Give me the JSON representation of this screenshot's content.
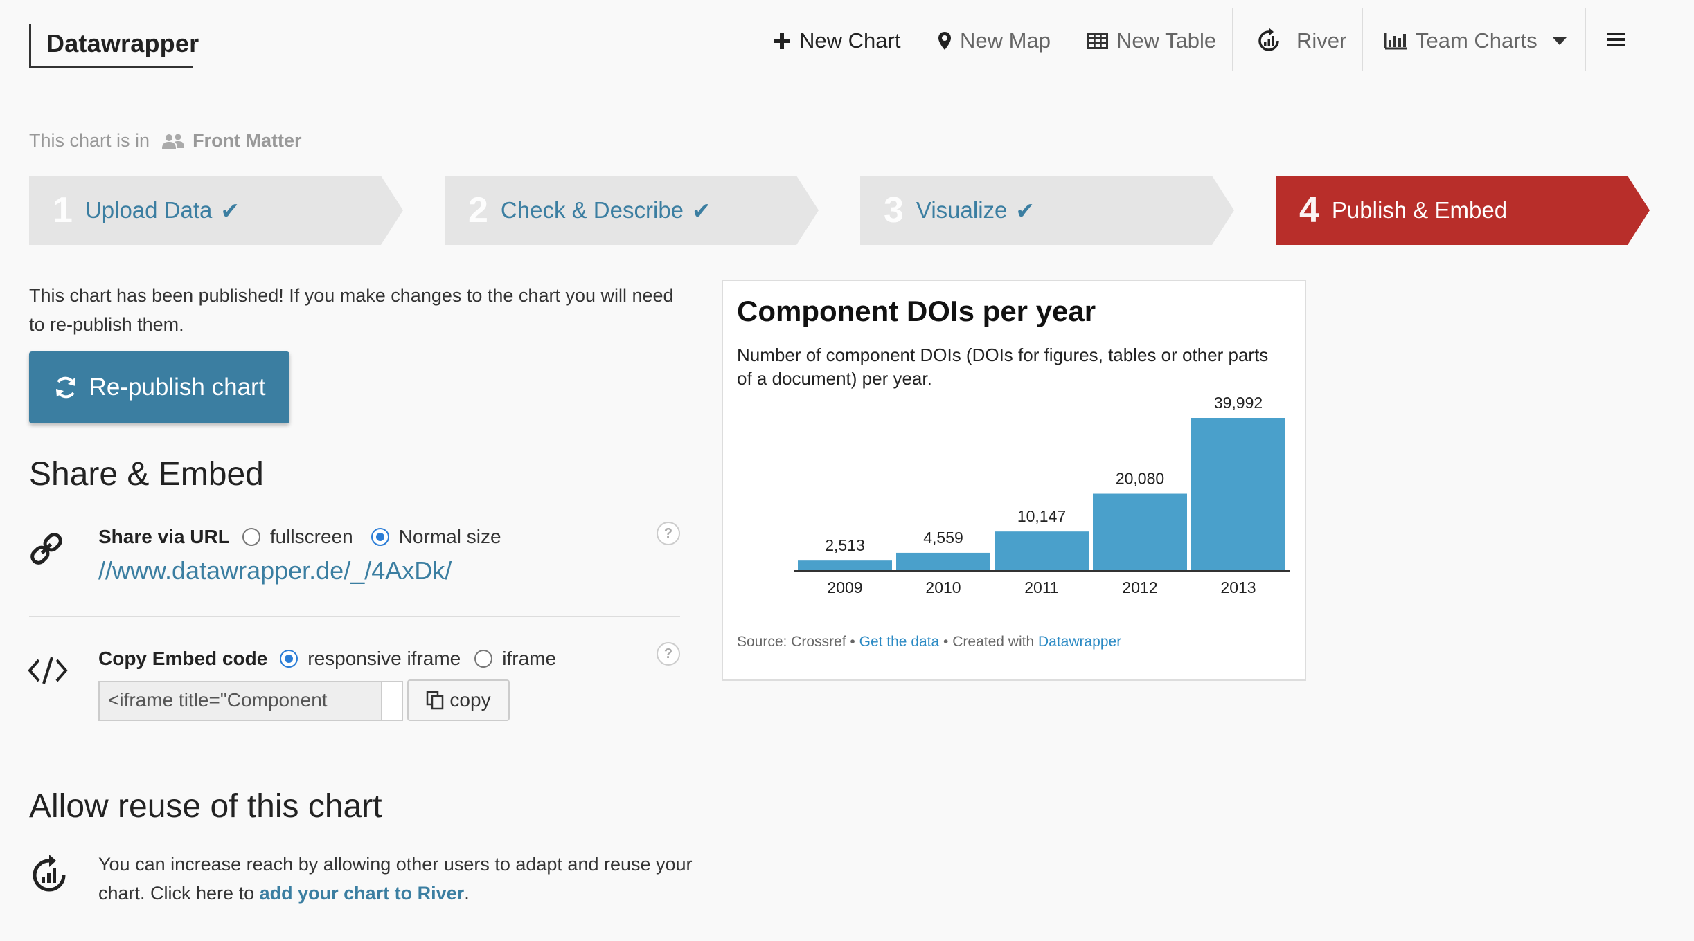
{
  "header": {
    "logo": "Datawrapper",
    "nav": {
      "new_chart": "New Chart",
      "new_map": "New Map",
      "new_table": "New Table",
      "river": "River",
      "team_charts": "Team Charts"
    }
  },
  "folder": {
    "prefix": "This chart is in",
    "name": "Front Matter"
  },
  "steps": [
    {
      "num": "1",
      "label": "Upload Data",
      "check": "✔"
    },
    {
      "num": "2",
      "label": "Check & Describe",
      "check": "✔"
    },
    {
      "num": "3",
      "label": "Visualize",
      "check": "✔"
    },
    {
      "num": "4",
      "label": "Publish & Embed"
    }
  ],
  "publish": {
    "notice": "This chart has been published! If you make changes to the chart you will need to re-publish them.",
    "republish_label": "Re-publish chart"
  },
  "share": {
    "heading": "Share & Embed",
    "url_label": "Share via URL",
    "opt_fullscreen": "fullscreen",
    "opt_normal": "Normal size",
    "url": "//www.datawrapper.de/_/4AxDk/",
    "embed_label": "Copy Embed code",
    "opt_responsive": "responsive iframe",
    "opt_iframe": "iframe",
    "embed_code": "<iframe title=\"Component",
    "copy_label": "copy",
    "help": "?"
  },
  "reuse": {
    "heading": "Allow reuse of this chart",
    "text": "You can increase reach by allowing other users to adapt and reuse your chart. Click here to",
    "link": "add your chart to River",
    "end": "."
  },
  "chart_data": {
    "type": "bar",
    "title": "Component DOIs per year",
    "subtitle": "Number of component DOIs (DOIs for figures, tables or other parts of a document) per year.",
    "categories": [
      "2009",
      "2010",
      "2011",
      "2012",
      "2013"
    ],
    "values": [
      2513,
      4559,
      10147,
      20080,
      39992
    ],
    "value_labels": [
      "2,513",
      "4,559",
      "10,147",
      "20,080",
      "39,992"
    ],
    "bar_color": "#4aa0cb",
    "source_prefix": "Source: Crossref",
    "get_data": "Get the data",
    "created_with": "Created with",
    "brand": "Datawrapper",
    "bullet": "•",
    "xlabel": "",
    "ylabel": ""
  },
  "colors": {
    "accent": "#3b7ea1",
    "active_step": "#b82e2a"
  }
}
